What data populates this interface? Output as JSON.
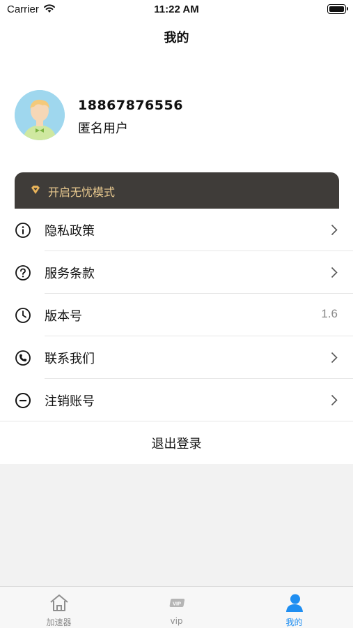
{
  "status_bar": {
    "carrier": "Carrier",
    "time": "11:22 AM"
  },
  "nav": {
    "title": "我的"
  },
  "profile": {
    "phone": "18867876556",
    "nickname": "匿名用户"
  },
  "vip_banner": {
    "label": "开启无忧模式",
    "accent": "#e8c98f"
  },
  "menu": [
    {
      "label": "隐私政策",
      "icon": "info-icon"
    },
    {
      "label": "服务条款",
      "icon": "question-icon"
    },
    {
      "label": "版本号",
      "icon": "clock-icon",
      "value": "1.6"
    },
    {
      "label": "联系我们",
      "icon": "phone-icon"
    },
    {
      "label": "注销账号",
      "icon": "minus-circle-icon"
    }
  ],
  "logout_label": "退出登录",
  "tabs": [
    {
      "label": "加速器",
      "icon": "home-icon"
    },
    {
      "label": "vip",
      "icon": "vip-icon"
    },
    {
      "label": "我的",
      "icon": "user-icon",
      "active": true
    }
  ],
  "colors": {
    "active_tab": "#1f8ef1",
    "banner_bg": "#3f3c39"
  }
}
